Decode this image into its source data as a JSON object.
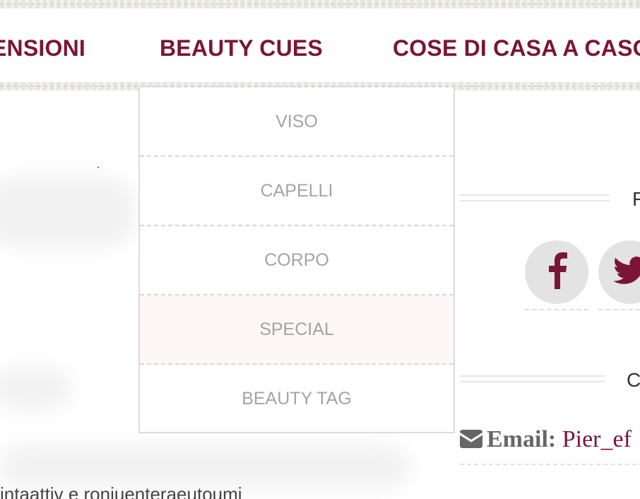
{
  "nav": {
    "items": [
      "ENSIONI",
      "BEAUTY CUES",
      "COSE DI CASA A CASO"
    ],
    "accent_color": "#7a1538"
  },
  "dropdown": {
    "items": [
      "VISO",
      "CAPELLI",
      "CORPO",
      "SPECIAL",
      "BEAUTY TAG"
    ],
    "hovered": "SPECIAL"
  },
  "sidebar": {
    "widget_1_title": "F",
    "widget_2_title": "C",
    "social": {
      "facebook_icon": "facebook-icon",
      "twitter_icon": "twitter-icon"
    },
    "email": {
      "icon": "envelope-icon",
      "label": "Email:",
      "value": "Pier_ef"
    }
  },
  "background_text": "intaattiv e roniuenteraeutoumi"
}
